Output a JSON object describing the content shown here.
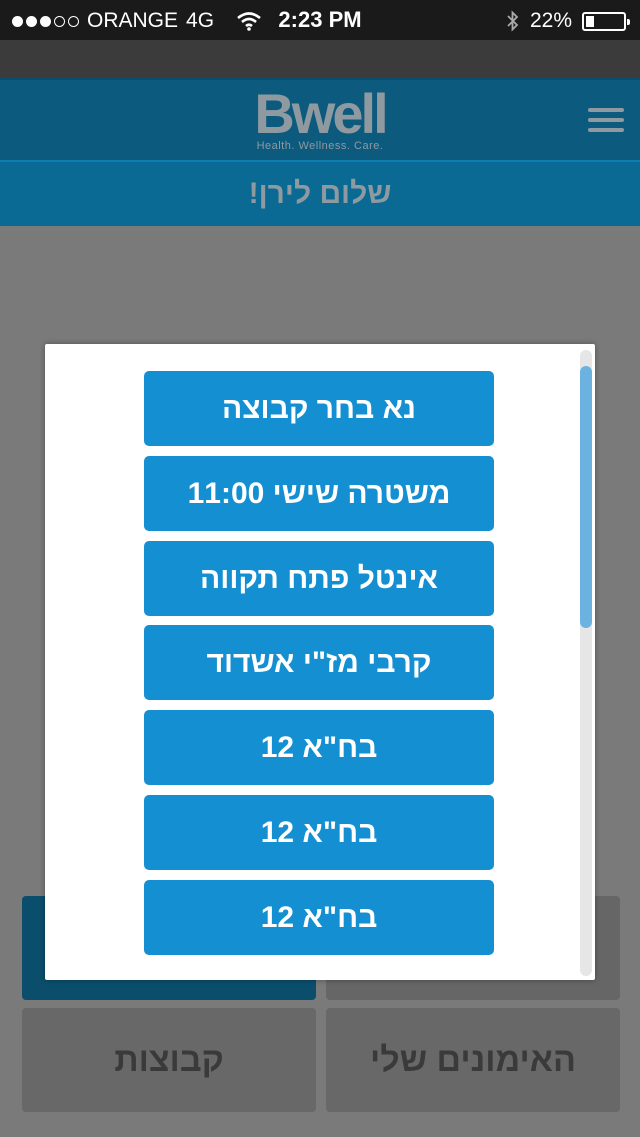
{
  "status_bar": {
    "carrier": "ORANGE",
    "network": "4G",
    "time": "2:23 PM",
    "battery_percent": "22%",
    "battery_level": 0.22,
    "signal_bars_filled": 3,
    "signal_bars_total": 5
  },
  "header": {
    "logo_main": "Bwell",
    "logo_sub": "Health. Wellness. Care."
  },
  "greeting": "שלום לירן!",
  "tiles": {
    "groups": "קבוצות",
    "my_trainings": "האימונים שלי"
  },
  "modal": {
    "options": [
      "נא בחר קבוצה",
      "משטרה שישי 11:00",
      "אינטל פתח תקווה",
      "קרבי מז\"י אשדוד",
      "בח\"א 12",
      "בח\"א 12",
      "בח\"א 12"
    ]
  },
  "colors": {
    "accent": "#1490d2",
    "header_bg": "#0c5a7e",
    "overlay_bg": "#7a7a7a"
  }
}
